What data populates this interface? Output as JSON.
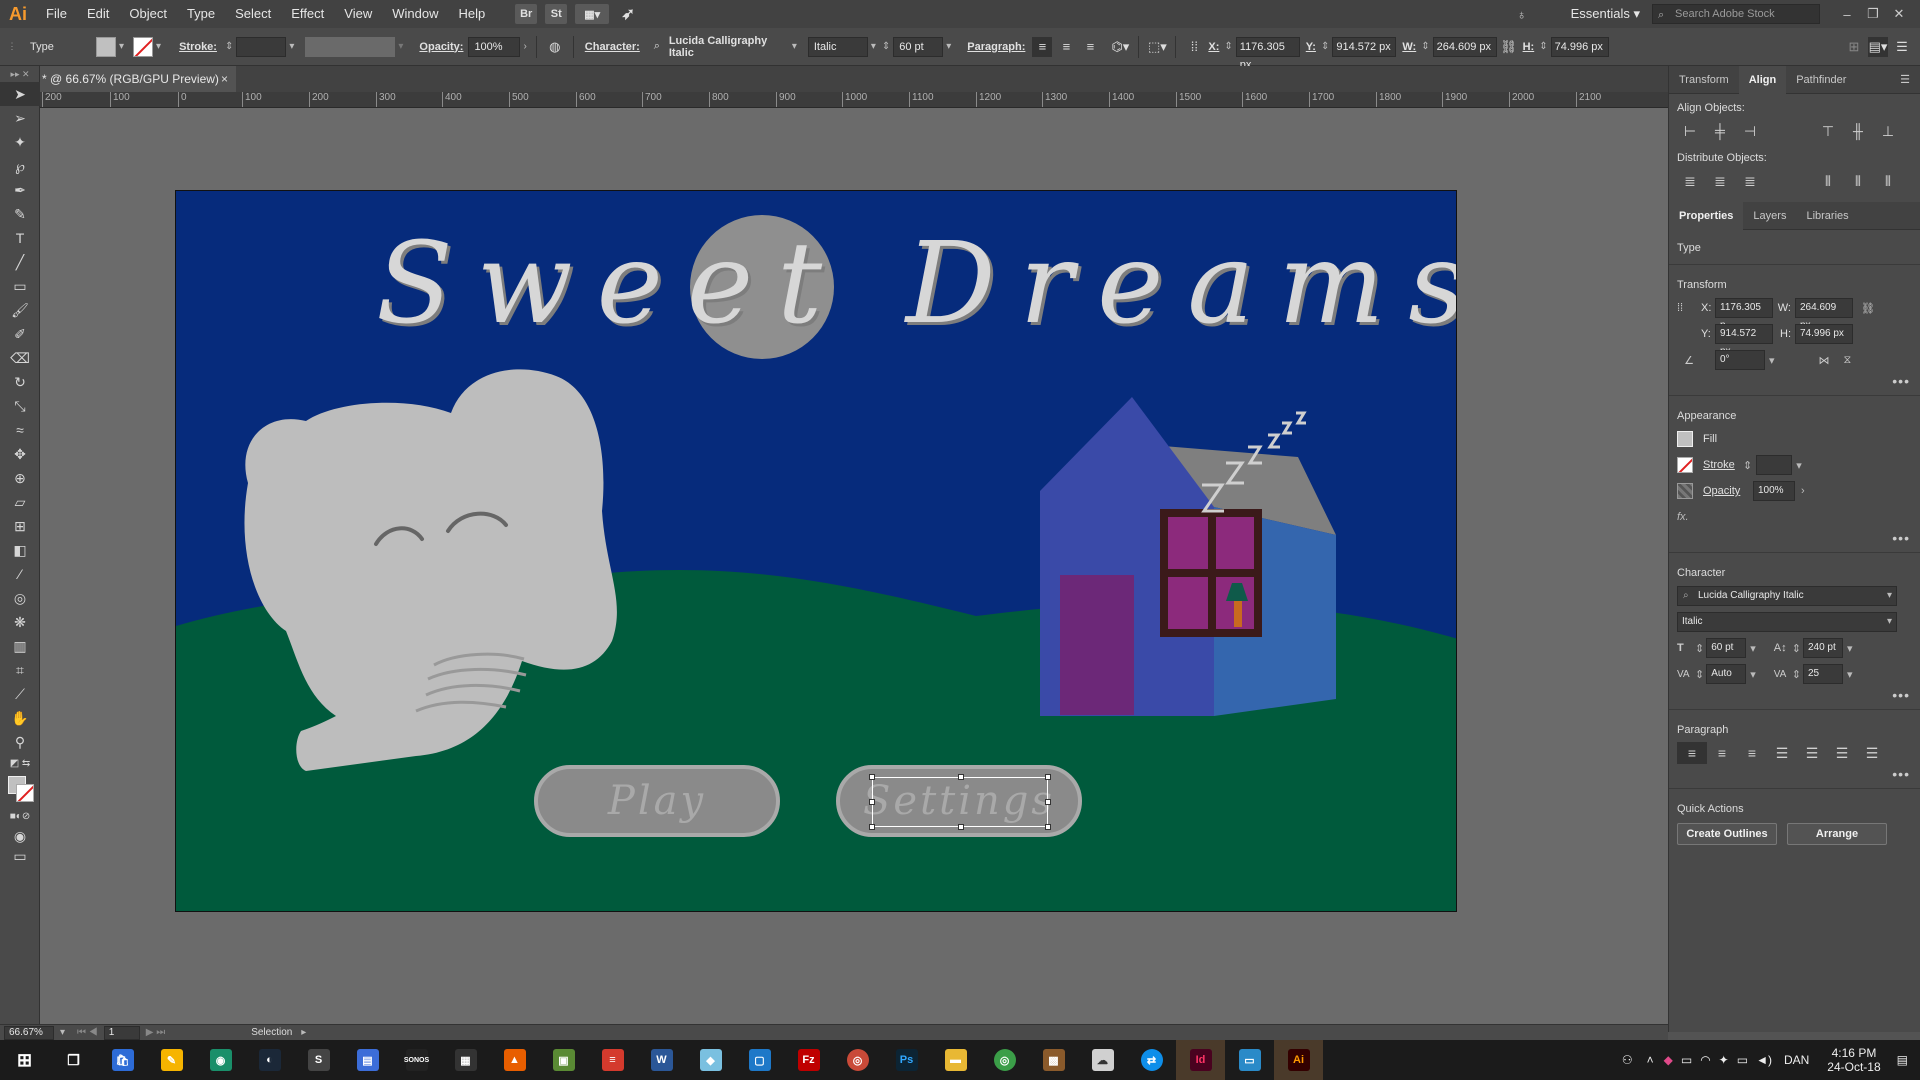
{
  "menubar": {
    "logo": "Ai",
    "items": [
      "File",
      "Edit",
      "Object",
      "Type",
      "Select",
      "Effect",
      "View",
      "Window",
      "Help"
    ],
    "bridge": "Br",
    "stock": "St",
    "workspace": "Essentials",
    "search_placeholder": "Search Adobe Stock"
  },
  "controlbar": {
    "selection_type": "Type",
    "stroke_label": "Stroke:",
    "opacity_label": "Opacity:",
    "opacity_value": "100%",
    "character_label": "Character:",
    "font_name": "Lucida Calligraphy Italic",
    "font_style": "Italic",
    "font_size": "60 pt",
    "paragraph_label": "Paragraph:",
    "x_label": "X:",
    "x_value": "1176.305 px",
    "y_label": "Y:",
    "y_value": "914.572 px",
    "w_label": "W:",
    "w_value": "264.609 px",
    "h_label": "H:",
    "h_value": "74.996 px"
  },
  "document": {
    "tab_title": "* @ 66.67% (RGB/GPU Preview)",
    "close": "×"
  },
  "ruler": {
    "ticks": [
      "200",
      "100",
      "0",
      "100",
      "200",
      "300",
      "400",
      "500",
      "600",
      "700",
      "800",
      "900",
      "1000",
      "1100",
      "1200",
      "1300",
      "1400",
      "1500",
      "1600",
      "1700",
      "1800",
      "1900",
      "2000",
      "2100"
    ]
  },
  "artboard": {
    "title": "Sweet Dreams",
    "play_label": "Play",
    "settings_label": "Settings",
    "zzz": "Z Z Z"
  },
  "panel_top": {
    "tabs": [
      "Transform",
      "Align",
      "Pathfinder"
    ],
    "align_objects": "Align Objects:",
    "distribute_objects": "Distribute Objects:"
  },
  "panel_props": {
    "tabs": [
      "Properties",
      "Layers",
      "Libraries"
    ],
    "type_label": "Type",
    "transform_label": "Transform",
    "x_value": "1176.305 p",
    "y_value": "914.572 px",
    "w_value": "264.609 px",
    "h_value": "74.996 px",
    "angle_value": "0°",
    "appearance_label": "Appearance",
    "fill_label": "Fill",
    "stroke_label": "Stroke",
    "opacity_label": "Opacity",
    "opacity_value": "100%",
    "fx_label": "fx.",
    "character_label": "Character",
    "font_name": "Lucida Calligraphy Italic",
    "font_style": "Italic",
    "font_size": "60 pt",
    "leading": "240 pt",
    "kerning": "Auto",
    "tracking": "25",
    "paragraph_label": "Paragraph",
    "quick_actions_label": "Quick Actions",
    "create_outlines": "Create Outlines",
    "arrange": "Arrange"
  },
  "statusbar": {
    "zoom": "66.67%",
    "page": "1",
    "mode": "Selection"
  },
  "taskbar": {
    "language": "DAN",
    "time": "4:16 PM",
    "date": "24-Oct-18"
  },
  "colors": {
    "sky": "#062b7c",
    "grass": "#005a3c",
    "house_front": "#3a4aa8",
    "house_side": "#3466ae",
    "roof": "#7f7f7f",
    "door": "#6c2878",
    "window": "#8c2a7c",
    "elephant": "#bdbdbd",
    "moon": "#8f8f8f"
  }
}
